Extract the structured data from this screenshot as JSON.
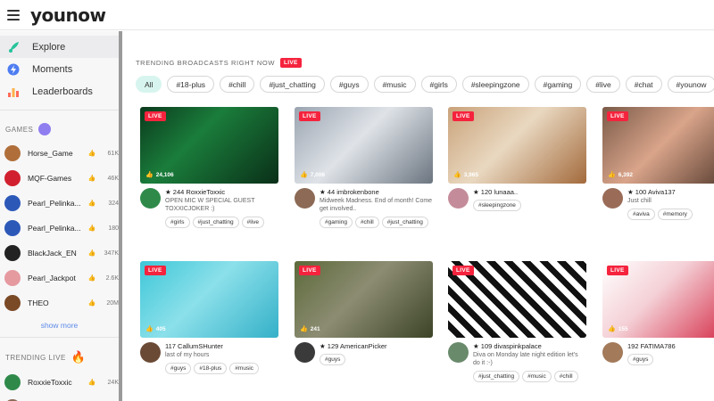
{
  "header": {
    "logo": "younow"
  },
  "nav": [
    {
      "label": "Explore",
      "icon": "rocket-icon"
    },
    {
      "label": "Moments",
      "icon": "lightning-icon"
    },
    {
      "label": "Leaderboards",
      "icon": "bar-chart-icon"
    }
  ],
  "games_title": "GAMES",
  "games": [
    {
      "name": "Horse_Game",
      "likes": "61K",
      "color": "#b06f3a"
    },
    {
      "name": "MQF-Games",
      "likes": "46K",
      "color": "#d1202f"
    },
    {
      "name": "Pearl_Pelinka...",
      "likes": "324",
      "color": "#2c58b8"
    },
    {
      "name": "Pearl_Pelinka...",
      "likes": "180",
      "color": "#2c58b8"
    },
    {
      "name": "BlackJack_EN",
      "likes": "347K",
      "color": "#222222"
    },
    {
      "name": "Pearl_Jackpot",
      "likes": "2.6K",
      "color": "#e59aa0"
    },
    {
      "name": "THEO",
      "likes": "20M",
      "color": "#7a4a26"
    }
  ],
  "show_more": "show more",
  "trending_title": "TRENDING LIVE",
  "trending": [
    {
      "name": "RoxxieToxxic",
      "likes": "24K",
      "color": "#2f8a4a"
    },
    {
      "name": "imbrokenbone",
      "likes": "2K",
      "color": "#8c6a55"
    }
  ],
  "main": {
    "title": "TRENDING BROADCASTS RIGHT NOW",
    "live": "LIVE",
    "tags": [
      "All",
      "#18-plus",
      "#chill",
      "#just_chatting",
      "#guys",
      "#music",
      "#girls",
      "#sleepingzone",
      "#gaming",
      "#live",
      "#chat",
      "#younow"
    ]
  },
  "cards": [
    {
      "live": "LIVE",
      "viewers": "24,106",
      "user": "★ 244 RoxxieToxxic",
      "desc": "OPEN MIC W SPECIAL GUEST TOXXICJOKER :)",
      "tags": [
        "#girls",
        "#just_chatting",
        "#live"
      ],
      "thumb": "linear-gradient(135deg,#0b3a1d,#1a7d3b 40%,#0a2f18)",
      "avatar": "#2f8a4a"
    },
    {
      "live": "LIVE",
      "viewers": "7,006",
      "user": "★ 44 imbrokenbone",
      "desc": "Midweek Madness. End of month! Come get involved..",
      "tags": [
        "#gaming",
        "#chill",
        "#just_chatting"
      ],
      "thumb": "linear-gradient(135deg,#9aa4b0,#dfe3e8 45%,#6b7580)",
      "avatar": "#8c6a55"
    },
    {
      "live": "LIVE",
      "viewers": "3,965",
      "user": "★ 120 lunaaa..",
      "desc": "",
      "tags": [
        "#sleepingzone"
      ],
      "thumb": "linear-gradient(135deg,#c9a27a,#e9d8c0 45%,#a36a3c)",
      "avatar": "#c48c9a"
    },
    {
      "live": "LIVE",
      "viewers": "6,392",
      "user": "★ 100 Aviva137",
      "desc": "Just chill",
      "tags": [
        "#aviva",
        "#memory"
      ],
      "thumb": "linear-gradient(135deg,#7a5a48,#d9a48a 45%,#4a3226)",
      "avatar": "#9a6c58"
    },
    {
      "live": "LIVE",
      "viewers": "405",
      "user": "117 CallumSHunter",
      "desc": "last of my hours",
      "tags": [
        "#guys",
        "#18-plus",
        "#music"
      ],
      "thumb": "linear-gradient(135deg,#3fc7d8,#8be0ea 45%,#34b0c8)",
      "avatar": "#6b4a35"
    },
    {
      "live": "LIVE",
      "viewers": "241",
      "user": "★ 129 AmericanPicker",
      "desc": "",
      "tags": [
        "#guys"
      ],
      "thumb": "linear-gradient(135deg,#5c6a3a,#8c8c72 45%,#3c4426)",
      "avatar": "#3a3a3a"
    },
    {
      "live": "LIVE",
      "viewers": "",
      "user": "★ 109 divaspinkpalace",
      "desc": "Diva on Monday late night edition let's do it :-)",
      "tags": [
        "#just_chatting",
        "#music",
        "#chill"
      ],
      "thumb": "repeating-linear-gradient(45deg,#ffffff 0 7px,#111111 7px 14px)",
      "avatar": "#6a8a6c"
    },
    {
      "live": "LIVE",
      "viewers": "155",
      "user": "192 FATIMA786",
      "desc": "",
      "tags": [
        "#guys"
      ],
      "thumb": "linear-gradient(135deg,#ffffff,#f4d0d6 40%,#d21f3c)",
      "avatar": "#a37a5a"
    }
  ]
}
